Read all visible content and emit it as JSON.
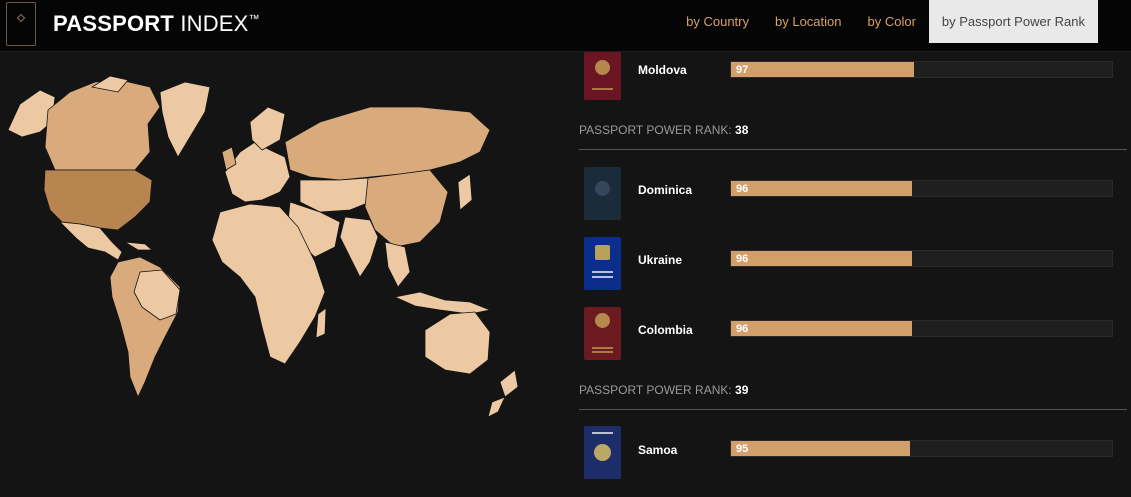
{
  "header": {
    "brand_bold": "PASSPORT",
    "brand_light": "INDEX",
    "brand_tm": "™",
    "nav": [
      {
        "label": "by Country",
        "active": false
      },
      {
        "label": "by Location",
        "active": false
      },
      {
        "label": "by Color",
        "active": false
      },
      {
        "label": "by Passport Power Rank",
        "active": true
      }
    ]
  },
  "colors": {
    "accent": "#d29e6a",
    "nav_link": "#d9a063",
    "map_light": "#ecc9a2",
    "map_mid": "#d9aa7c",
    "map_dark": "#b8844f"
  },
  "rank_label": "PASSPORT POWER RANK:",
  "rows": [
    {
      "country": "Moldova",
      "score": "97",
      "fill_percent": 48,
      "passport_color": "#6a1424",
      "emblem": "#c8a458"
    },
    {
      "country": "Dominica",
      "score": "96",
      "fill_percent": 47.5,
      "passport_color": "#1c2b3a",
      "emblem": "#3b4f63"
    },
    {
      "country": "Ukraine",
      "score": "96",
      "fill_percent": 47.5,
      "passport_color": "#0a2e8a",
      "emblem": "#e2c14a"
    },
    {
      "country": "Colombia",
      "score": "96",
      "fill_percent": 47.5,
      "passport_color": "#6b1a20",
      "emblem": "#c8a458"
    },
    {
      "country": "Samoa",
      "score": "95",
      "fill_percent": 47,
      "passport_color": "#1c2d6a",
      "emblem": "#e4c665"
    }
  ],
  "ranks": [
    {
      "rank": "38"
    },
    {
      "rank": "39"
    }
  ]
}
